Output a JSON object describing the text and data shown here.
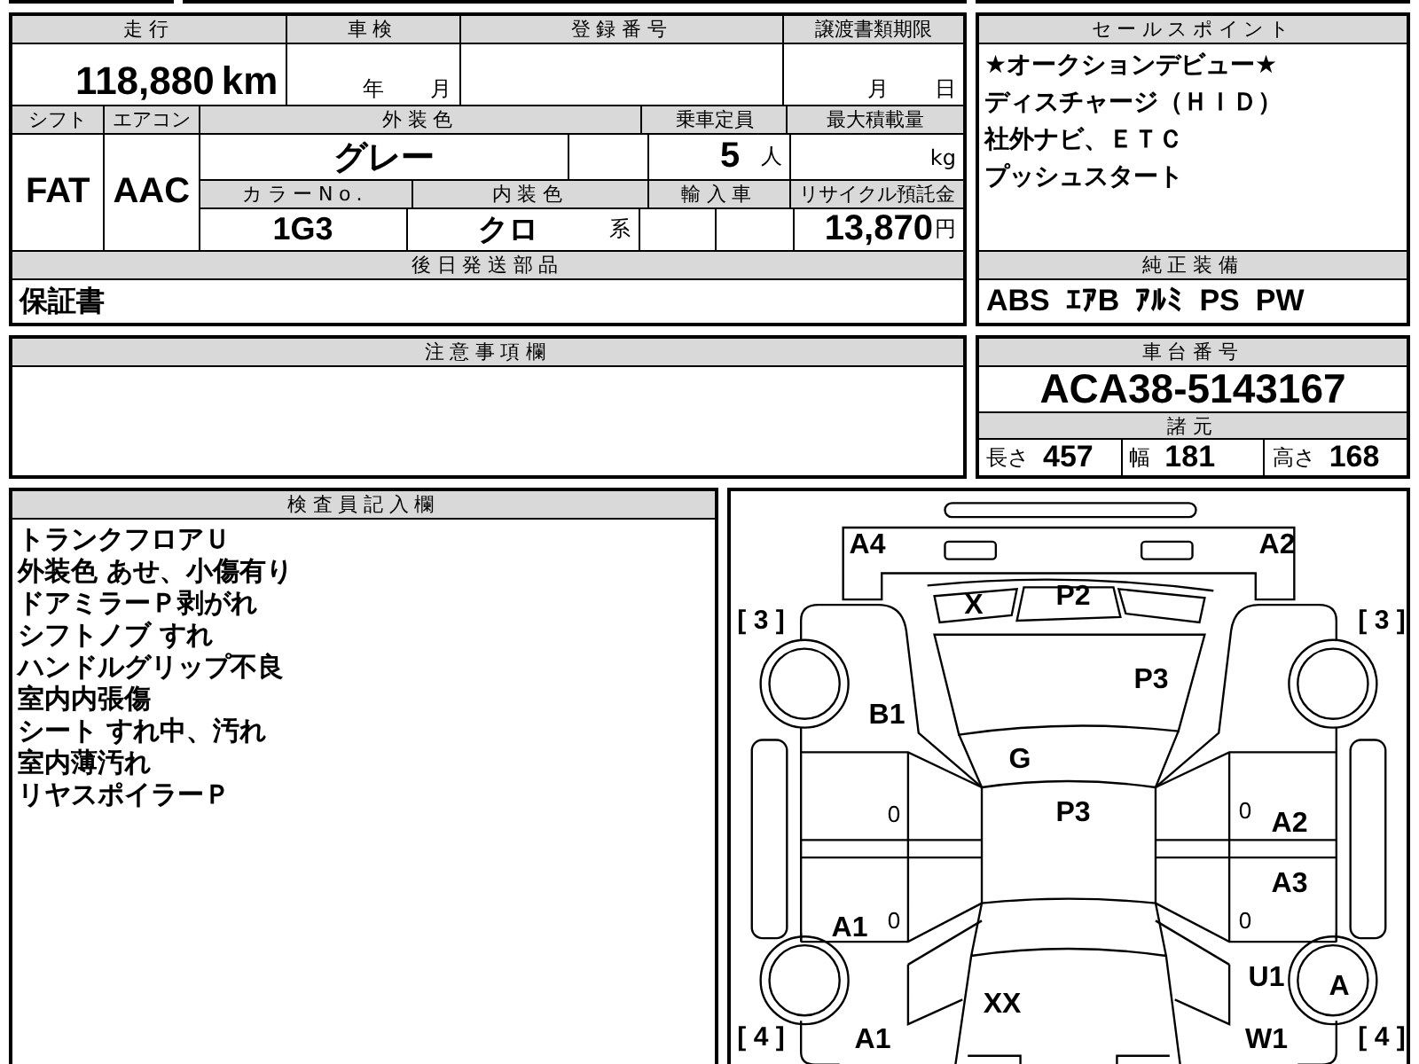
{
  "mileage": {
    "label": "走行",
    "value": "118,880",
    "unit": "km"
  },
  "inspection": {
    "label": "車検",
    "year_unit": "年",
    "month_unit": "月"
  },
  "registration": {
    "label": "登録番号"
  },
  "transfer_deadline": {
    "label": "譲渡書類期限",
    "month_unit": "月",
    "day_unit": "日"
  },
  "shift": {
    "label": "シフト",
    "value": "FAT"
  },
  "aircon": {
    "label": "エアコン",
    "value": "AAC"
  },
  "exterior_color": {
    "label": "外装色",
    "value": "グレー"
  },
  "capacity": {
    "label": "乗車定員",
    "value": "5",
    "unit": "人"
  },
  "max_load": {
    "label": "最大積載量",
    "unit": "kg"
  },
  "color_no": {
    "label": "カラーNo.",
    "value": "1G3"
  },
  "interior_color": {
    "label": "内装色",
    "value": "クロ",
    "suffix": "系"
  },
  "imported": {
    "label": "輸入車"
  },
  "recycle_fee": {
    "label": "リサイクル預託金",
    "value": "13,870",
    "unit": "円"
  },
  "parts_to_ship": {
    "label": "後日発送部品",
    "value": "保証書"
  },
  "sales_points": {
    "label": "セールスポイント",
    "lines": [
      "★オークションデビュー★",
      "ディスチャージ（ＨＩＤ）",
      "社外ナビ、ＥＴＣ",
      "プッシュスタート"
    ]
  },
  "standard_equipment": {
    "label": "純正装備",
    "items": [
      "ABS",
      "ｴｱB",
      "ｱﾙﾐ",
      "PS",
      "PW"
    ]
  },
  "notes": {
    "label": "注意事項欄"
  },
  "chassis": {
    "label": "車台番号",
    "value": "ACA38-5143167"
  },
  "specs": {
    "label": "諸元",
    "items": [
      {
        "label": "長さ",
        "value": "457"
      },
      {
        "label": "幅",
        "value": "181"
      },
      {
        "label": "高さ",
        "value": "168"
      }
    ]
  },
  "inspector_notes": {
    "label": "検査員記入欄",
    "lines": [
      "トランクフロアＵ",
      "外装色 あせ、小傷有り",
      "ドアミラーＰ剥がれ",
      "シフトノブ すれ",
      "ハンドルグリップ不良",
      "室内内張傷",
      "シート すれ中、汚れ",
      "室内薄汚れ",
      "リヤスポイラーＰ"
    ]
  },
  "damage_diagram": {
    "marks": [
      {
        "kind": "code",
        "text": "A4"
      },
      {
        "kind": "code",
        "text": "A2"
      },
      {
        "kind": "code",
        "text": "X"
      },
      {
        "kind": "code",
        "text": "P2"
      },
      {
        "kind": "code",
        "text": "P3"
      },
      {
        "kind": "code",
        "text": "B1"
      },
      {
        "kind": "code",
        "text": "G"
      },
      {
        "kind": "code",
        "text": "P3"
      },
      {
        "kind": "code",
        "text": "A2"
      },
      {
        "kind": "code",
        "text": "A3"
      },
      {
        "kind": "code",
        "text": "A1"
      },
      {
        "kind": "code",
        "text": "U1"
      },
      {
        "kind": "code",
        "text": "A"
      },
      {
        "kind": "code",
        "text": "XX"
      },
      {
        "kind": "code",
        "text": "A1"
      },
      {
        "kind": "code",
        "text": "W1"
      },
      {
        "kind": "small",
        "text": "0"
      },
      {
        "kind": "small",
        "text": "0"
      },
      {
        "kind": "small",
        "text": "0"
      },
      {
        "kind": "small",
        "text": "0"
      },
      {
        "kind": "rating",
        "text": "[ 3 ]"
      },
      {
        "kind": "rating",
        "text": "[ 3 ]"
      },
      {
        "kind": "rating",
        "text": "[ 4 ]"
      },
      {
        "kind": "rating",
        "text": "[ 4 ]"
      }
    ]
  }
}
